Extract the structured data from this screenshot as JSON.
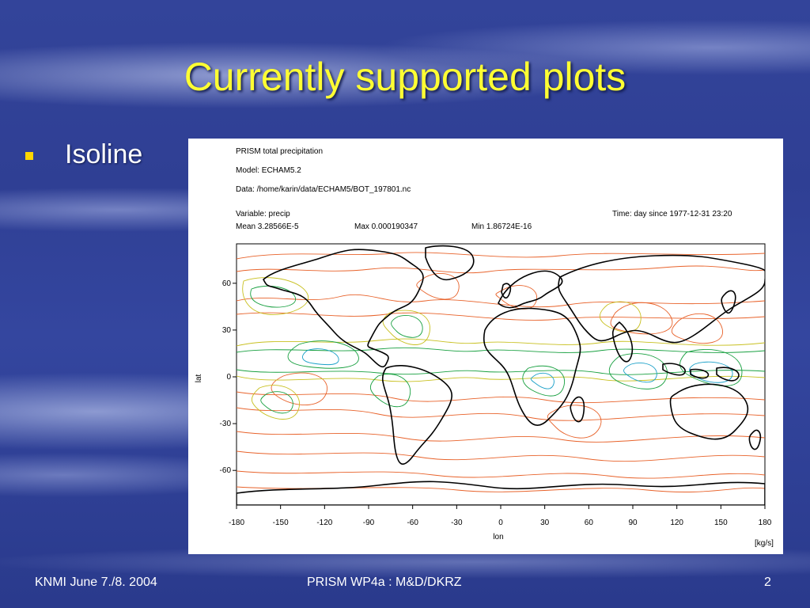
{
  "slide": {
    "title": "Currently supported plots",
    "bullets": [
      "Isoline"
    ],
    "footer_left": "KNMI June 7./8. 2004",
    "footer_center": "PRISM WP4a :  M&D/DKRZ",
    "footer_right": "2"
  },
  "figure": {
    "header": {
      "line1": "PRISM     total precipitation",
      "line2": "Model:     ECHAM5.2",
      "line3": "Data:      /home/karin/data/ECHAM5/BOT_197801.nc",
      "variable": "Variable:  precip",
      "time": "Time:  day since 1977-12-31 23:20",
      "mean": "Mean 3.28566E-5",
      "max": "Max 0.000190347",
      "min": "Min 1.86724E-16"
    },
    "xlabel": "lon",
    "ylabel": "lat",
    "units": "[kg/s]",
    "x_ticks": [
      "-180",
      "-150",
      "-120",
      "-90",
      "-60",
      "-30",
      "0",
      "30",
      "60",
      "90",
      "120",
      "150",
      "180"
    ],
    "y_ticks": [
      "60",
      "30",
      "0",
      "-30",
      "-60"
    ]
  },
  "colors": {
    "title": "#ffff33",
    "bullet": "#ffd600",
    "contour_low": "#e8622a",
    "contour_mid": "#c8c020",
    "contour_high": "#18a040",
    "contour_max": "#1aa0c8"
  }
}
